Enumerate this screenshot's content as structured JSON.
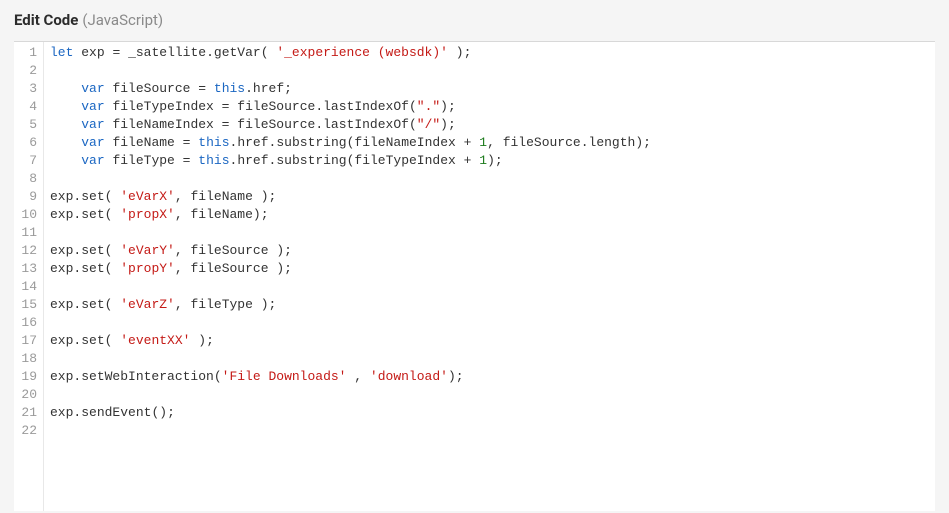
{
  "header": {
    "title": "Edit Code",
    "language": "(JavaScript)"
  },
  "code": {
    "lines": [
      {
        "n": 1,
        "tokens": [
          [
            "kw",
            "let"
          ],
          [
            "sp",
            " "
          ],
          [
            "id",
            "exp"
          ],
          [
            "sp",
            " "
          ],
          [
            "op",
            "="
          ],
          [
            "sp",
            " "
          ],
          [
            "id",
            "_satellite"
          ],
          [
            "pun",
            "."
          ],
          [
            "id",
            "getVar"
          ],
          [
            "pun",
            "("
          ],
          [
            "sp",
            " "
          ],
          [
            "str",
            "'_experience (websdk)'"
          ],
          [
            "sp",
            " "
          ],
          [
            "pun",
            ")"
          ],
          [
            "pun",
            ";"
          ]
        ]
      },
      {
        "n": 2,
        "tokens": []
      },
      {
        "n": 3,
        "tokens": [
          [
            "sp",
            "    "
          ],
          [
            "kw",
            "var"
          ],
          [
            "sp",
            " "
          ],
          [
            "id",
            "fileSource"
          ],
          [
            "sp",
            " "
          ],
          [
            "op",
            "="
          ],
          [
            "sp",
            " "
          ],
          [
            "kw",
            "this"
          ],
          [
            "pun",
            "."
          ],
          [
            "id",
            "href"
          ],
          [
            "pun",
            ";"
          ]
        ]
      },
      {
        "n": 4,
        "tokens": [
          [
            "sp",
            "    "
          ],
          [
            "kw",
            "var"
          ],
          [
            "sp",
            " "
          ],
          [
            "id",
            "fileTypeIndex"
          ],
          [
            "sp",
            " "
          ],
          [
            "op",
            "="
          ],
          [
            "sp",
            " "
          ],
          [
            "id",
            "fileSource"
          ],
          [
            "pun",
            "."
          ],
          [
            "id",
            "lastIndexOf"
          ],
          [
            "pun",
            "("
          ],
          [
            "str",
            "\".\""
          ],
          [
            "pun",
            ")"
          ],
          [
            "pun",
            ";"
          ]
        ]
      },
      {
        "n": 5,
        "tokens": [
          [
            "sp",
            "    "
          ],
          [
            "kw",
            "var"
          ],
          [
            "sp",
            " "
          ],
          [
            "id",
            "fileNameIndex"
          ],
          [
            "sp",
            " "
          ],
          [
            "op",
            "="
          ],
          [
            "sp",
            " "
          ],
          [
            "id",
            "fileSource"
          ],
          [
            "pun",
            "."
          ],
          [
            "id",
            "lastIndexOf"
          ],
          [
            "pun",
            "("
          ],
          [
            "str",
            "\"/\""
          ],
          [
            "pun",
            ")"
          ],
          [
            "pun",
            ";"
          ]
        ]
      },
      {
        "n": 6,
        "tokens": [
          [
            "sp",
            "    "
          ],
          [
            "kw",
            "var"
          ],
          [
            "sp",
            " "
          ],
          [
            "id",
            "fileName"
          ],
          [
            "sp",
            " "
          ],
          [
            "op",
            "="
          ],
          [
            "sp",
            " "
          ],
          [
            "kw",
            "this"
          ],
          [
            "pun",
            "."
          ],
          [
            "id",
            "href"
          ],
          [
            "pun",
            "."
          ],
          [
            "id",
            "substring"
          ],
          [
            "pun",
            "("
          ],
          [
            "id",
            "fileNameIndex"
          ],
          [
            "sp",
            " "
          ],
          [
            "op",
            "+"
          ],
          [
            "sp",
            " "
          ],
          [
            "num",
            "1"
          ],
          [
            "pun",
            ","
          ],
          [
            "sp",
            " "
          ],
          [
            "id",
            "fileSource"
          ],
          [
            "pun",
            "."
          ],
          [
            "id",
            "length"
          ],
          [
            "pun",
            ")"
          ],
          [
            "pun",
            ";"
          ]
        ]
      },
      {
        "n": 7,
        "tokens": [
          [
            "sp",
            "    "
          ],
          [
            "kw",
            "var"
          ],
          [
            "sp",
            " "
          ],
          [
            "id",
            "fileType"
          ],
          [
            "sp",
            " "
          ],
          [
            "op",
            "="
          ],
          [
            "sp",
            " "
          ],
          [
            "kw",
            "this"
          ],
          [
            "pun",
            "."
          ],
          [
            "id",
            "href"
          ],
          [
            "pun",
            "."
          ],
          [
            "id",
            "substring"
          ],
          [
            "pun",
            "("
          ],
          [
            "id",
            "fileTypeIndex"
          ],
          [
            "sp",
            " "
          ],
          [
            "op",
            "+"
          ],
          [
            "sp",
            " "
          ],
          [
            "num",
            "1"
          ],
          [
            "pun",
            ")"
          ],
          [
            "pun",
            ";"
          ]
        ]
      },
      {
        "n": 8,
        "tokens": []
      },
      {
        "n": 9,
        "tokens": [
          [
            "id",
            "exp"
          ],
          [
            "pun",
            "."
          ],
          [
            "id",
            "set"
          ],
          [
            "pun",
            "("
          ],
          [
            "sp",
            " "
          ],
          [
            "str",
            "'eVarX'"
          ],
          [
            "pun",
            ","
          ],
          [
            "sp",
            " "
          ],
          [
            "id",
            "fileName"
          ],
          [
            "sp",
            " "
          ],
          [
            "pun",
            ")"
          ],
          [
            "pun",
            ";"
          ]
        ]
      },
      {
        "n": 10,
        "tokens": [
          [
            "id",
            "exp"
          ],
          [
            "pun",
            "."
          ],
          [
            "id",
            "set"
          ],
          [
            "pun",
            "("
          ],
          [
            "sp",
            " "
          ],
          [
            "str",
            "'propX'"
          ],
          [
            "pun",
            ","
          ],
          [
            "sp",
            " "
          ],
          [
            "id",
            "fileName"
          ],
          [
            "pun",
            ")"
          ],
          [
            "pun",
            ";"
          ]
        ]
      },
      {
        "n": 11,
        "tokens": []
      },
      {
        "n": 12,
        "tokens": [
          [
            "id",
            "exp"
          ],
          [
            "pun",
            "."
          ],
          [
            "id",
            "set"
          ],
          [
            "pun",
            "("
          ],
          [
            "sp",
            " "
          ],
          [
            "str",
            "'eVarY'"
          ],
          [
            "pun",
            ","
          ],
          [
            "sp",
            " "
          ],
          [
            "id",
            "fileSource"
          ],
          [
            "sp",
            " "
          ],
          [
            "pun",
            ")"
          ],
          [
            "pun",
            ";"
          ]
        ]
      },
      {
        "n": 13,
        "tokens": [
          [
            "id",
            "exp"
          ],
          [
            "pun",
            "."
          ],
          [
            "id",
            "set"
          ],
          [
            "pun",
            "("
          ],
          [
            "sp",
            " "
          ],
          [
            "str",
            "'propY'"
          ],
          [
            "pun",
            ","
          ],
          [
            "sp",
            " "
          ],
          [
            "id",
            "fileSource"
          ],
          [
            "sp",
            " "
          ],
          [
            "pun",
            ")"
          ],
          [
            "pun",
            ";"
          ]
        ]
      },
      {
        "n": 14,
        "tokens": []
      },
      {
        "n": 15,
        "tokens": [
          [
            "id",
            "exp"
          ],
          [
            "pun",
            "."
          ],
          [
            "id",
            "set"
          ],
          [
            "pun",
            "("
          ],
          [
            "sp",
            " "
          ],
          [
            "str",
            "'eVarZ'"
          ],
          [
            "pun",
            ","
          ],
          [
            "sp",
            " "
          ],
          [
            "id",
            "fileType"
          ],
          [
            "sp",
            " "
          ],
          [
            "pun",
            ")"
          ],
          [
            "pun",
            ";"
          ]
        ]
      },
      {
        "n": 16,
        "tokens": []
      },
      {
        "n": 17,
        "tokens": [
          [
            "id",
            "exp"
          ],
          [
            "pun",
            "."
          ],
          [
            "id",
            "set"
          ],
          [
            "pun",
            "("
          ],
          [
            "sp",
            " "
          ],
          [
            "str",
            "'eventXX'"
          ],
          [
            "sp",
            " "
          ],
          [
            "pun",
            ")"
          ],
          [
            "pun",
            ";"
          ]
        ]
      },
      {
        "n": 18,
        "tokens": []
      },
      {
        "n": 19,
        "tokens": [
          [
            "id",
            "exp"
          ],
          [
            "pun",
            "."
          ],
          [
            "id",
            "setWebInteraction"
          ],
          [
            "pun",
            "("
          ],
          [
            "str",
            "'File Downloads'"
          ],
          [
            "sp",
            " "
          ],
          [
            "pun",
            ","
          ],
          [
            "sp",
            " "
          ],
          [
            "str",
            "'download'"
          ],
          [
            "pun",
            ")"
          ],
          [
            "pun",
            ";"
          ]
        ]
      },
      {
        "n": 20,
        "tokens": []
      },
      {
        "n": 21,
        "tokens": [
          [
            "id",
            "exp"
          ],
          [
            "pun",
            "."
          ],
          [
            "id",
            "sendEvent"
          ],
          [
            "pun",
            "("
          ],
          [
            "pun",
            ")"
          ],
          [
            "pun",
            ";"
          ]
        ]
      },
      {
        "n": 22,
        "tokens": []
      }
    ]
  }
}
